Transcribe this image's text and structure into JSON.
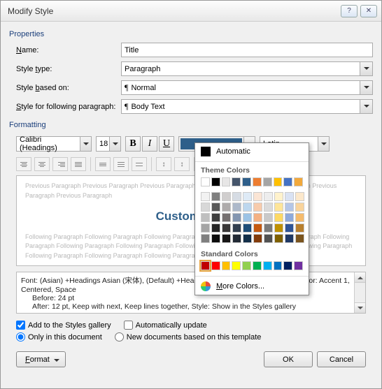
{
  "title": "Modify Style",
  "properties_label": "Properties",
  "name_label": "Name:",
  "name_value": "Title",
  "style_type_label": "Style type:",
  "style_type_value": "Paragraph",
  "based_on_label": "Style based on:",
  "based_on_value": "Normal",
  "following_label": "Style for following paragraph:",
  "following_value": "Body Text",
  "formatting_label": "Formatting",
  "font_name": "Calibri (Headings)",
  "font_size": "18",
  "script": "Latin",
  "automatic_label": "Automatic",
  "theme_colors_label": "Theme Colors",
  "standard_colors_label": "Standard Colors",
  "more_colors_label": "More Colors...",
  "preview_prev": "Previous Paragraph Previous Paragraph Previous Paragraph Previous Paragraph Previous Paragraph Previous Paragraph Previous Paragraph",
  "preview_title": "Custom Wor",
  "preview_next": "Following Paragraph Following Paragraph Following Paragraph Following Paragraph Following Paragraph Following Paragraph Following Paragraph Following Paragraph Following Paragraph Following Paragraph Following Paragraph Following Paragraph Following Paragraph Following Paragraph",
  "desc_line1": "Font: (Asian) +Headings Asian (宋体), (Default) +Headings (Calibri), 18 pt, Bold, Font color: Accent 1, Centered, Space",
  "desc_line2": "Before:  24 pt",
  "desc_line3": "After:  12 pt, Keep with next, Keep lines together, Style: Show in the Styles gallery",
  "add_gallery_label": "Add to the Styles gallery",
  "auto_update_label": "Automatically update",
  "only_doc_label": "Only in this document",
  "new_docs_label": "New documents based on this template",
  "format_btn": "Format",
  "ok_btn": "OK",
  "cancel_btn": "Cancel",
  "theme_row1": [
    "#ffffff",
    "#000000",
    "#e7e6e6",
    "#44546a",
    "#2e5f8a",
    "#ed7d31",
    "#a5a5a5",
    "#ffc000",
    "#4472c4",
    "#f2a93c"
  ],
  "theme_shades": [
    [
      "#f2f2f2",
      "#7f7f7f",
      "#d0cece",
      "#d6dce4",
      "#deeaf6",
      "#fbe5d5",
      "#ededed",
      "#fff2cc",
      "#d9e2f3",
      "#fce8cb"
    ],
    [
      "#d8d8d8",
      "#595959",
      "#aeabab",
      "#adb9ca",
      "#bdd7ee",
      "#f7cbac",
      "#dbdbdb",
      "#fee599",
      "#b4c6e7",
      "#f9d49c"
    ],
    [
      "#bfbfbf",
      "#3f3f3f",
      "#757070",
      "#8496b0",
      "#9cc3e5",
      "#f4b183",
      "#c9c9c9",
      "#fdd964",
      "#8eaadb",
      "#f5bb6c"
    ],
    [
      "#a5a5a5",
      "#262626",
      "#3a3838",
      "#323f4f",
      "#1f4e79",
      "#c55a11",
      "#7b7b7b",
      "#bf9000",
      "#2f5496",
      "#b87f2e"
    ],
    [
      "#7f7f7f",
      "#0c0c0c",
      "#171616",
      "#222a35",
      "#132f49",
      "#833c0b",
      "#525252",
      "#7f6000",
      "#1f3864",
      "#7a541e"
    ]
  ],
  "standard_row": [
    "#c00000",
    "#ff0000",
    "#ffc000",
    "#ffff00",
    "#92d050",
    "#00b050",
    "#00b0f0",
    "#0070c0",
    "#002060",
    "#7030a0"
  ]
}
